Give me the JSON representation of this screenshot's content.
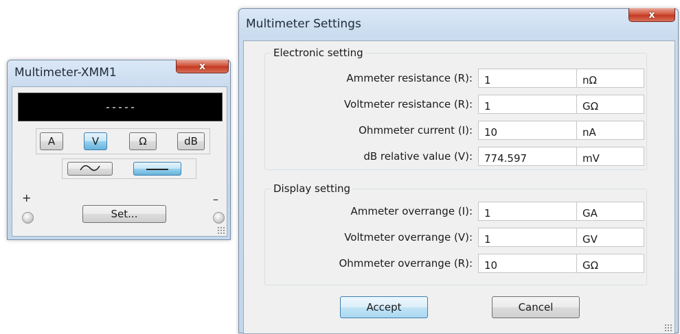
{
  "meter": {
    "title": "Multimeter-XMM1",
    "close_label": "x",
    "display_text": "-----",
    "modes": [
      "A",
      "V",
      "Ω",
      "dB"
    ],
    "active_mode": "V",
    "set_label": "Set...",
    "plus_label": "+",
    "minus_label": "–"
  },
  "settings": {
    "title": "Multimeter Settings",
    "close_label": "x",
    "electronic": {
      "legend": "Electronic setting",
      "rows": [
        {
          "label": "Ammeter resistance (R):",
          "value": "1",
          "unit": "nΩ"
        },
        {
          "label": "Voltmeter resistance (R):",
          "value": "1",
          "unit": "GΩ"
        },
        {
          "label": "Ohmmeter current (I):",
          "value": "10",
          "unit": "nA"
        },
        {
          "label": "dB relative value (V):",
          "value": "774.597",
          "unit": "mV"
        }
      ]
    },
    "display": {
      "legend": "Display setting",
      "rows": [
        {
          "label": "Ammeter overrange (I):",
          "value": "1",
          "unit": "GA"
        },
        {
          "label": "Voltmeter overrange (V):",
          "value": "1",
          "unit": "GV"
        },
        {
          "label": "Ohmmeter overrange (R):",
          "value": "10",
          "unit": "GΩ"
        }
      ]
    },
    "accept_label": "Accept",
    "cancel_label": "Cancel"
  },
  "colors": {
    "accent_pressed": "#98d1ef",
    "close_red": "#c43a22",
    "display_bg": "#000000"
  }
}
